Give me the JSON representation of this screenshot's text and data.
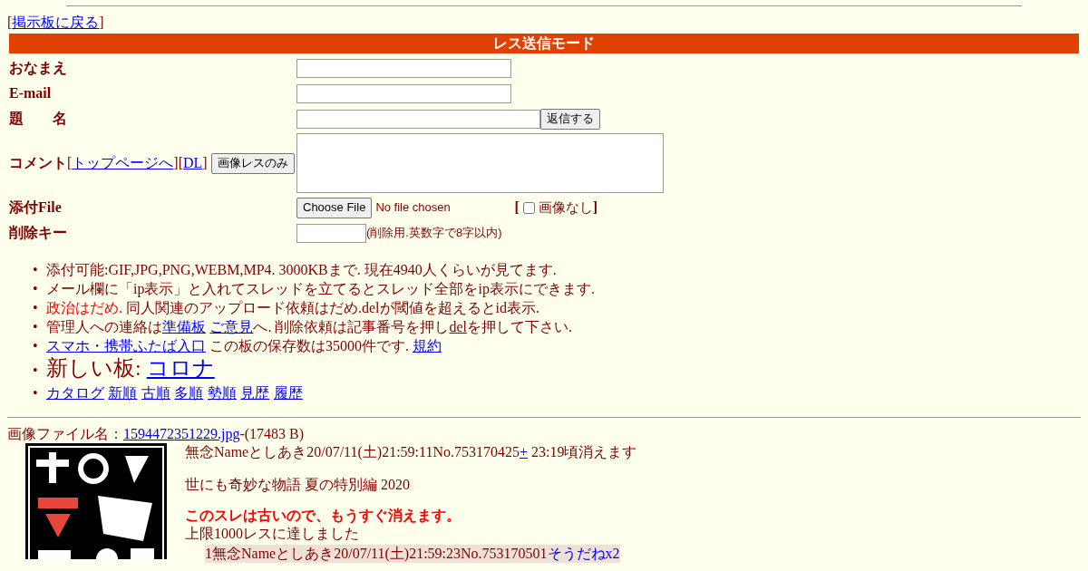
{
  "back_link": {
    "before": "[",
    "label": "掲示板に戻る",
    "after": "]"
  },
  "form": {
    "title": "レス送信モード",
    "rows": [
      {
        "kind": "input",
        "label": "おなまえ"
      },
      {
        "kind": "input",
        "label": "E-mail"
      },
      {
        "kind": "subject",
        "label": "題　　名",
        "button": "返信する"
      },
      {
        "kind": "comment",
        "label": "コメント",
        "extras": [
          {
            "kind": "text",
            "text": "["
          },
          {
            "kind": "link",
            "text": "トップページへ"
          },
          {
            "kind": "text",
            "text": "]["
          },
          {
            "kind": "link",
            "text": "DL"
          },
          {
            "kind": "text",
            "text": "]"
          }
        ],
        "button": "画像レスのみ"
      },
      {
        "kind": "file",
        "label": "添付File",
        "button": "Choose File",
        "status": "No file chosen",
        "checkbox": {
          "before": "[",
          "label": "画像なし",
          "after": "]",
          "checked": false
        }
      },
      {
        "kind": "key",
        "label": "削除キー",
        "note": "(削除用.英数字で8字以内)"
      }
    ]
  },
  "notices": [
    {
      "kind": "normal",
      "marker": "•",
      "parts": [
        {
          "kind": "text",
          "text": "添付可能:GIF,JPG,PNG,WEBM,MP4. 3000KBまで. 現在4940人くらいが見てます."
        }
      ]
    },
    {
      "kind": "normal",
      "marker": "•",
      "parts": [
        {
          "kind": "text",
          "text": "メール欄に「ip表示」と入れてスレッドを立てるとスレッド全部をip表示にできます."
        }
      ]
    },
    {
      "kind": "normal",
      "marker": "•",
      "parts": [
        {
          "kind": "alert",
          "text": "政治はだめ."
        },
        {
          "kind": "text",
          "text": " 同人関連のアップロード依頼はだめ.delが閾値を超えるとid表示."
        }
      ]
    },
    {
      "kind": "normal",
      "marker": "•",
      "parts": [
        {
          "kind": "text",
          "text": "管理人への連絡は"
        },
        {
          "kind": "link",
          "text": "準備板",
          "space_after": true
        },
        {
          "kind": "link",
          "text": "ご意見"
        },
        {
          "kind": "text",
          "text": "へ. 削除依頼は記事番号を押し"
        },
        {
          "kind": "underline",
          "text": "del"
        },
        {
          "kind": "text",
          "text": "を押して下さい."
        }
      ]
    },
    {
      "kind": "normal",
      "marker": "•",
      "parts": [
        {
          "kind": "link",
          "text": "スマホ・携帯ふたば入口"
        },
        {
          "kind": "text",
          "text": " この板の保存数は35000件です. "
        },
        {
          "kind": "link",
          "text": "規約"
        }
      ]
    },
    {
      "kind": "large",
      "marker": "•",
      "parts": [
        {
          "kind": "text",
          "text": "新しい板: "
        },
        {
          "kind": "link",
          "text": "コロナ"
        }
      ]
    },
    {
      "kind": "normal",
      "marker": "•",
      "parts": [
        {
          "kind": "link",
          "text": "カタログ",
          "space_after": true
        },
        {
          "kind": "link",
          "text": "新順",
          "space_after": true
        },
        {
          "kind": "link",
          "text": "古順",
          "space_after": true
        },
        {
          "kind": "link",
          "text": "多順",
          "space_after": true
        },
        {
          "kind": "link",
          "text": "勢順",
          "space_after": true
        },
        {
          "kind": "link",
          "text": "見歴",
          "space_after": true
        },
        {
          "kind": "link",
          "text": "履歴"
        }
      ]
    }
  ],
  "thread": {
    "file_label": "画像ファイル名：",
    "file_link": "1594472351229.jpg",
    "file_size": "-(17483 B)",
    "post": {
      "header": "無念Nameとしあき20/07/11(土)21:59:11No.753170425",
      "plus": "+",
      "expiry": " 23:19頃消えます",
      "body": "世にも奇妙な物語 夏の特別編 2020",
      "warning": "このスレは古いので、もうすぐ消えます。",
      "limit": "上限1000レスに達しました"
    },
    "replies": [
      {
        "header": "1無念Nameとしあき20/07/11(土)21:59:23No.753170501",
        "sodane": "そうだねx2"
      }
    ]
  }
}
